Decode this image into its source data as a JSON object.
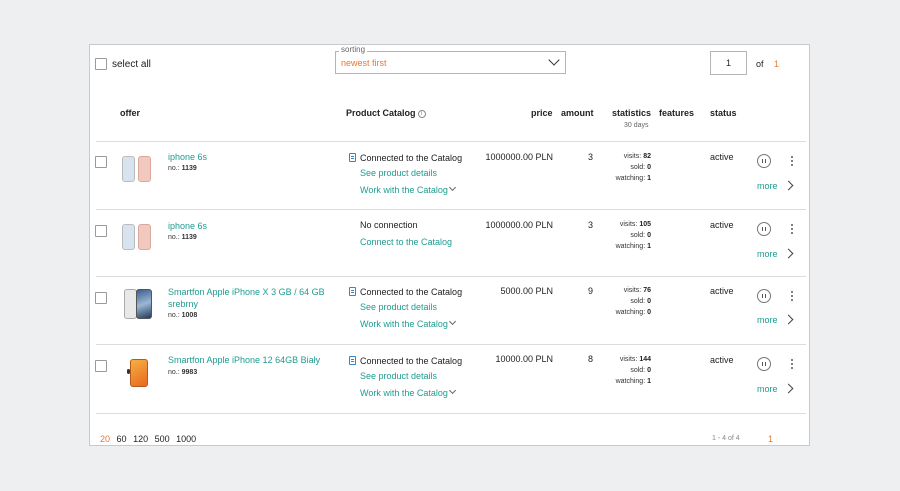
{
  "toolbar": {
    "select_all_label": "select all",
    "sorting_legend": "sorting",
    "sorting_value": "newest first",
    "page_input_value": "1",
    "of_label": "of",
    "total_pages": "1"
  },
  "columns": {
    "offer": "offer",
    "product_catalog": "Product Catalog",
    "price": "price",
    "amount": "amount",
    "statistics": "statistics",
    "statistics_sub": "30 days",
    "features": "features",
    "status": "status"
  },
  "rows": [
    {
      "name": "iphone 6s",
      "no_label": "no.:",
      "no": "1139",
      "catalog_status": "Connected to the Catalog",
      "catalog_link1": "See product details",
      "catalog_link2": "Work with the Catalog",
      "price": "1000000.00 PLN",
      "amount": "3",
      "visits_label": "visits:",
      "visits": "82",
      "sold_label": "sold:",
      "sold": "0",
      "watching_label": "watching:",
      "watching": "1",
      "status": "active",
      "more": "more",
      "thumb_icon": "iphone-6s-rose-gold"
    },
    {
      "name": "iphone 6s",
      "no_label": "no.:",
      "no": "1139",
      "catalog_status": "No connection",
      "catalog_link1": "Connect to the Catalog",
      "price": "1000000.00 PLN",
      "amount": "3",
      "visits_label": "visits:",
      "visits": "105",
      "sold_label": "sold:",
      "sold": "0",
      "watching_label": "watching:",
      "watching": "1",
      "status": "active",
      "more": "more",
      "thumb_icon": "iphone-6s-rose-gold"
    },
    {
      "name": "Smartfon Apple iPhone X 3 GB / 64 GB srebrny",
      "no_label": "no.:",
      "no": "1008",
      "catalog_status": "Connected to the Catalog",
      "catalog_link1": "See product details",
      "catalog_link2": "Work with the Catalog",
      "price": "5000.00 PLN",
      "amount": "9",
      "visits_label": "visits:",
      "visits": "76",
      "sold_label": "sold:",
      "sold": "0",
      "watching_label": "watching:",
      "watching": "0",
      "status": "active",
      "more": "more",
      "thumb_icon": "iphone-x-silver"
    },
    {
      "name": "Smartfon Apple iPhone 12 64GB Biały",
      "no_label": "no.:",
      "no": "9983",
      "catalog_status": "Connected to the Catalog",
      "catalog_link1": "See product details",
      "catalog_link2": "Work with the Catalog",
      "price": "10000.00 PLN",
      "amount": "8",
      "visits_label": "visits:",
      "visits": "144",
      "sold_label": "sold:",
      "sold": "0",
      "watching_label": "watching:",
      "watching": "1",
      "status": "active",
      "more": "more",
      "thumb_icon": "iphone-12-orange"
    }
  ],
  "pager": {
    "sizes": [
      "20",
      "60",
      "120",
      "500",
      "1000"
    ],
    "active_size": "20",
    "range": "1 - 4 of 4",
    "current_page": "1"
  },
  "colors": {
    "accent_orange": "#e8772e",
    "link_teal": "#1e9c8f",
    "catalog_icon_blue": "#3a84c4"
  }
}
